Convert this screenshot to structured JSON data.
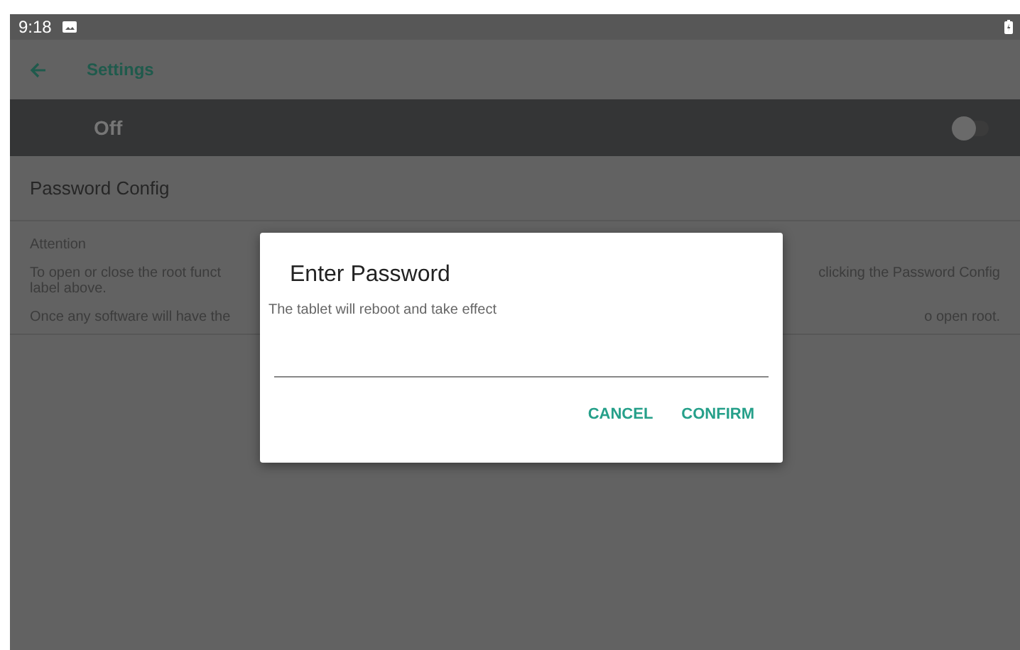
{
  "status_bar": {
    "time": "9:18"
  },
  "toolbar": {
    "title": "Settings"
  },
  "master_switch": {
    "label": "Off",
    "on": false
  },
  "password_config": {
    "label": "Password Config"
  },
  "attention": {
    "heading": "Attention",
    "paragraphs": [
      {
        "left": "To open or close the root funct",
        "left_line_2": "label above.",
        "right": "clicking the Password Config"
      },
      {
        "left": "Once any software will have the",
        "right": "o open root."
      }
    ]
  },
  "dialog": {
    "title": "Enter Password",
    "message": "The tablet will reboot and take effect",
    "buttons": [
      "CANCEL",
      "CONFIRM"
    ]
  }
}
